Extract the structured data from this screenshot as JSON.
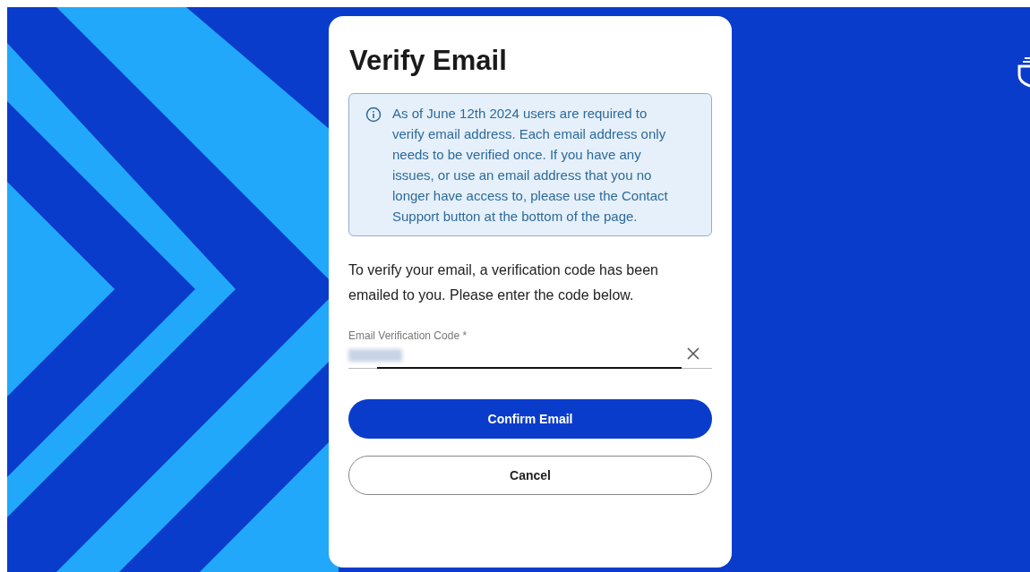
{
  "dialog": {
    "title": "Verify Email",
    "notice": "As of June 12th 2024 users are required to verify email address. Each email address only needs to be verified once. If you have any issues, or use an email address that you no longer have access to, please use the Contact Support button at the bottom of the page.",
    "instructions": "To verify your email, a verification code has been emailed to you. Please enter the code below.",
    "field": {
      "label": "Email Verification Code *"
    },
    "buttons": [
      {
        "label": "Confirm Email",
        "kind": "primary"
      },
      {
        "label": "Cancel",
        "kind": "secondary"
      }
    ]
  }
}
